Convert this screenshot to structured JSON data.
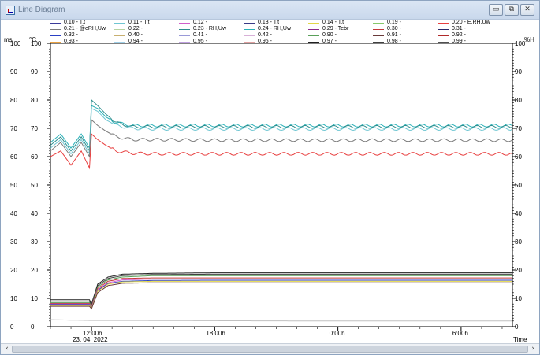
{
  "window": {
    "title": "Line Diagram",
    "buttons": {
      "minimize": "▭",
      "restore": "⧉",
      "close": "✕"
    }
  },
  "legend": [
    {
      "label": "0.10 - T,t",
      "color": "#3b3b9a"
    },
    {
      "label": "0.11 - T,t",
      "color": "#6fc6d2"
    },
    {
      "label": "0.12 -",
      "color": "#d25fcb"
    },
    {
      "label": "0.13 - T,t",
      "color": "#3a3a86"
    },
    {
      "label": "0.14 - T,t",
      "color": "#e2d848"
    },
    {
      "label": "0.19 -",
      "color": "#86c86a"
    },
    {
      "label": "0.20 - E.RH,Uw",
      "color": "#e84040"
    },
    {
      "label": "0.21 - @eRH,Uw",
      "color": "#7a7a7a"
    },
    {
      "label": "0.22 -",
      "color": "#b7d3a2"
    },
    {
      "label": "0.23 - RH,Uw",
      "color": "#2e8e8e"
    },
    {
      "label": "0.24 - RH,Uw",
      "color": "#2ab1b8"
    },
    {
      "label": "0.29 - Tebr",
      "color": "#8a2a8a"
    },
    {
      "label": "0.30 -",
      "color": "#c43a3a"
    },
    {
      "label": "0.31 -",
      "color": "#2a2a6a"
    },
    {
      "label": "0.32 -",
      "color": "#2a40c4"
    },
    {
      "label": "0.40 -",
      "color": "#c8b070"
    },
    {
      "label": "0.41 -",
      "color": "#9a9ad8"
    },
    {
      "label": "0.42 -",
      "color": "#d8b0d8"
    },
    {
      "label": "0.90 -",
      "color": "#5aa05a"
    },
    {
      "label": "0.91 -",
      "color": "#6a3a3a"
    },
    {
      "label": "0.92 -",
      "color": "#b02a2a"
    },
    {
      "label": "0.93 -",
      "color": "#e8a040"
    },
    {
      "label": "0.94 -",
      "color": "#a0d0e8"
    },
    {
      "label": "0.95 -",
      "color": "#c0a0e0"
    },
    {
      "label": "0.96 -",
      "color": "#e0a0a0"
    },
    {
      "label": "0.97 -",
      "color": "#202020"
    },
    {
      "label": "0.98 -",
      "color": "#404040"
    },
    {
      "label": "0.99 -",
      "color": "#505050"
    }
  ],
  "axes": {
    "left_unit_1": "ms",
    "left_unit_2": "°C",
    "right_unit": "%H",
    "x_unit": "Time",
    "date_label": "23. 04. 2022",
    "y_ticks": [
      "100",
      "90",
      "80",
      "70",
      "60",
      "50",
      "40",
      "30",
      "20",
      "10",
      "0"
    ],
    "x_ticks": [
      "12:00h",
      "18:00h",
      "0:00h",
      "6:00h"
    ]
  },
  "chart_data": {
    "type": "line",
    "ylim": [
      0,
      100
    ],
    "xlim_hours": [
      10,
      32.5
    ],
    "x_ticks_hours": [
      12,
      18,
      24,
      30
    ],
    "y_ticks": [
      0,
      10,
      20,
      30,
      40,
      50,
      60,
      70,
      80,
      90,
      100
    ],
    "series": [
      {
        "color": "#2ab1b8",
        "x": [
          10,
          10.5,
          11,
          11.5,
          11.9,
          12,
          12.3,
          12.7,
          13.2,
          14,
          15,
          18,
          24,
          30,
          32.5
        ],
        "y": [
          65,
          68,
          63,
          68,
          63,
          78,
          77,
          74,
          72,
          71,
          71,
          71,
          71,
          71,
          71
        ]
      },
      {
        "color": "#2e8e8e",
        "x": [
          10,
          10.5,
          11,
          11.5,
          11.9,
          12,
          12.3,
          12.7,
          13.2,
          14,
          15,
          18,
          24,
          30,
          32.5
        ],
        "y": [
          64,
          67,
          62,
          67,
          62,
          80,
          78,
          75,
          72,
          70.5,
          70.5,
          70.5,
          70.5,
          70.5,
          70.5
        ]
      },
      {
        "color": "#6fc6d2",
        "x": [
          10,
          10.5,
          11,
          11.5,
          11.9,
          12,
          12.3,
          12.7,
          13.2,
          14,
          15,
          18,
          24,
          30,
          32.5
        ],
        "y": [
          63,
          66,
          61,
          66,
          61,
          77,
          76,
          73,
          71,
          70,
          69.8,
          69.8,
          69.8,
          69.8,
          69.8
        ]
      },
      {
        "color": "#7a7a7a",
        "x": [
          10,
          10.5,
          11,
          11.5,
          11.9,
          12,
          12.3,
          12.7,
          13.2,
          14,
          15,
          18,
          24,
          30,
          32.5
        ],
        "y": [
          62,
          65,
          60,
          65,
          60,
          73,
          71,
          69,
          67,
          66,
          66,
          65.8,
          65.8,
          65.8,
          65.8
        ]
      },
      {
        "color": "#e84040",
        "x": [
          10,
          10.5,
          11,
          11.5,
          11.9,
          12,
          12.3,
          12.7,
          13.2,
          14,
          15,
          18,
          24,
          30,
          32.5
        ],
        "y": [
          60,
          62,
          57,
          62,
          56,
          68,
          66,
          64,
          62,
          61.2,
          61,
          61,
          61,
          61,
          61
        ]
      },
      {
        "color": "#202020",
        "x": [
          10,
          11.9,
          12,
          12.3,
          12.8,
          13.5,
          15,
          18,
          24,
          30,
          32.5
        ],
        "y": [
          9.5,
          9.5,
          8,
          15,
          17.5,
          18.5,
          18.8,
          19,
          19,
          19,
          19
        ]
      },
      {
        "color": "#404040",
        "x": [
          10,
          11.9,
          12,
          12.3,
          12.8,
          13.5,
          15,
          18,
          24,
          30,
          32.5
        ],
        "y": [
          9,
          9,
          7.5,
          14.5,
          17,
          18,
          18.4,
          18.5,
          18.5,
          18.5,
          18.5
        ]
      },
      {
        "color": "#5aa05a",
        "x": [
          10,
          11.9,
          12,
          12.3,
          12.8,
          13.5,
          15,
          18,
          24,
          30,
          32.5
        ],
        "y": [
          8.5,
          8.5,
          7,
          14,
          16.5,
          17.5,
          18,
          18,
          18,
          18,
          18
        ]
      },
      {
        "color": "#c43a3a",
        "x": [
          10,
          11.9,
          12,
          12.3,
          12.8,
          13.5,
          15,
          18,
          24,
          30,
          32.5
        ],
        "y": [
          8.2,
          8.2,
          7,
          13.5,
          16,
          17,
          17.2,
          17.2,
          17.2,
          17.2,
          17.2
        ]
      },
      {
        "color": "#d25fcb",
        "x": [
          10,
          11.9,
          12,
          12.3,
          12.8,
          13.5,
          15,
          18,
          24,
          30,
          32.5
        ],
        "y": [
          8,
          8,
          6.8,
          13,
          15.5,
          16.5,
          16.8,
          16.8,
          16.8,
          16.8,
          16.8
        ]
      },
      {
        "color": "#2a40c4",
        "x": [
          10,
          11.9,
          12,
          12.3,
          12.8,
          13.5,
          15,
          18,
          24,
          30,
          32.5
        ],
        "y": [
          7.8,
          7.8,
          6.6,
          12.8,
          15.2,
          16,
          16.3,
          16.4,
          16.4,
          16.4,
          16.4
        ]
      },
      {
        "color": "#e2d848",
        "x": [
          10,
          11.9,
          12,
          12.3,
          12.8,
          13.5,
          15,
          18,
          24,
          30,
          32.5
        ],
        "y": [
          7.5,
          7.5,
          6.5,
          12.5,
          15,
          15.8,
          16,
          16,
          16,
          16,
          16
        ]
      },
      {
        "color": "#6a3a3a",
        "x": [
          10,
          11.9,
          12,
          12.3,
          12.8,
          13.5,
          15,
          18,
          24,
          30,
          32.5
        ],
        "y": [
          7.2,
          7.2,
          6.3,
          12,
          14.5,
          15.3,
          15.5,
          15.5,
          15.5,
          15.5,
          15.5
        ]
      },
      {
        "color": "#c0c0c0",
        "x": [
          10,
          11,
          12,
          14,
          18,
          24,
          30,
          32.5
        ],
        "y": [
          2.5,
          2.3,
          2.2,
          2.2,
          2.1,
          2,
          2,
          2
        ]
      }
    ]
  }
}
